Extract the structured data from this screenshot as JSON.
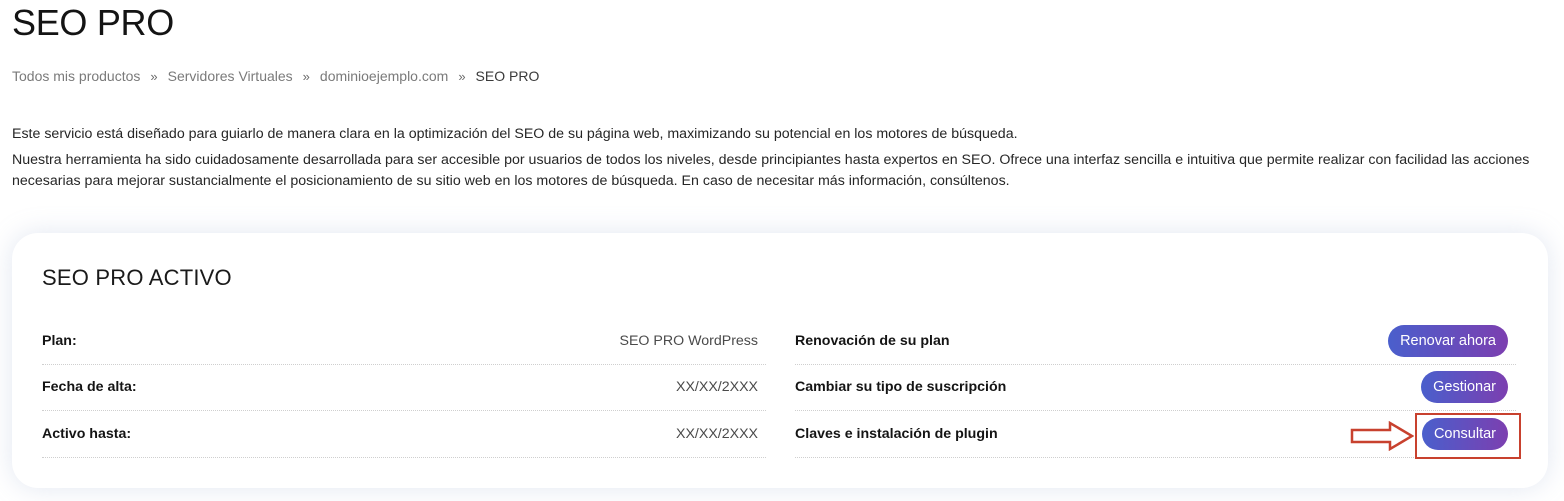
{
  "page": {
    "title": "SEO PRO"
  },
  "breadcrumb": {
    "items": [
      "Todos mis productos",
      "Servidores Virtuales",
      "dominioejemplo.com"
    ],
    "separator": "»",
    "current": "SEO PRO"
  },
  "intro": {
    "paragraph_1": "Este servicio está diseñado para guiarlo de manera clara en la optimización del SEO de su página web, maximizando su potencial en los motores de búsqueda.",
    "paragraph_2": "Nuestra herramienta ha sido cuidadosamente desarrollada para ser accesible por usuarios de todos los niveles, desde principiantes hasta expertos en SEO. Ofrece una interfaz sencilla e intuitiva que permite realizar con facilidad las acciones necesarias para mejorar sustancialmente el posicionamiento de su sitio web en los motores de búsqueda. En caso de necesitar más información, consúltenos."
  },
  "card": {
    "title": "SEO PRO ACTIVO",
    "details": [
      {
        "label": "Plan:",
        "value": "SEO PRO WordPress"
      },
      {
        "label": "Fecha de alta:",
        "value": "XX/XX/2XXX"
      },
      {
        "label": "Activo hasta:",
        "value": "XX/XX/2XXX"
      }
    ],
    "actions": [
      {
        "label": "Renovación de su plan",
        "button": "Renovar ahora"
      },
      {
        "label": "Cambiar su tipo de suscripción",
        "button": "Gestionar"
      },
      {
        "label": "Claves e instalación de plugin",
        "button": "Consultar"
      }
    ]
  },
  "colors": {
    "button_gradient_start": "#4a5fcc",
    "button_gradient_end": "#7c3fb0",
    "highlight": "#c8412e"
  }
}
